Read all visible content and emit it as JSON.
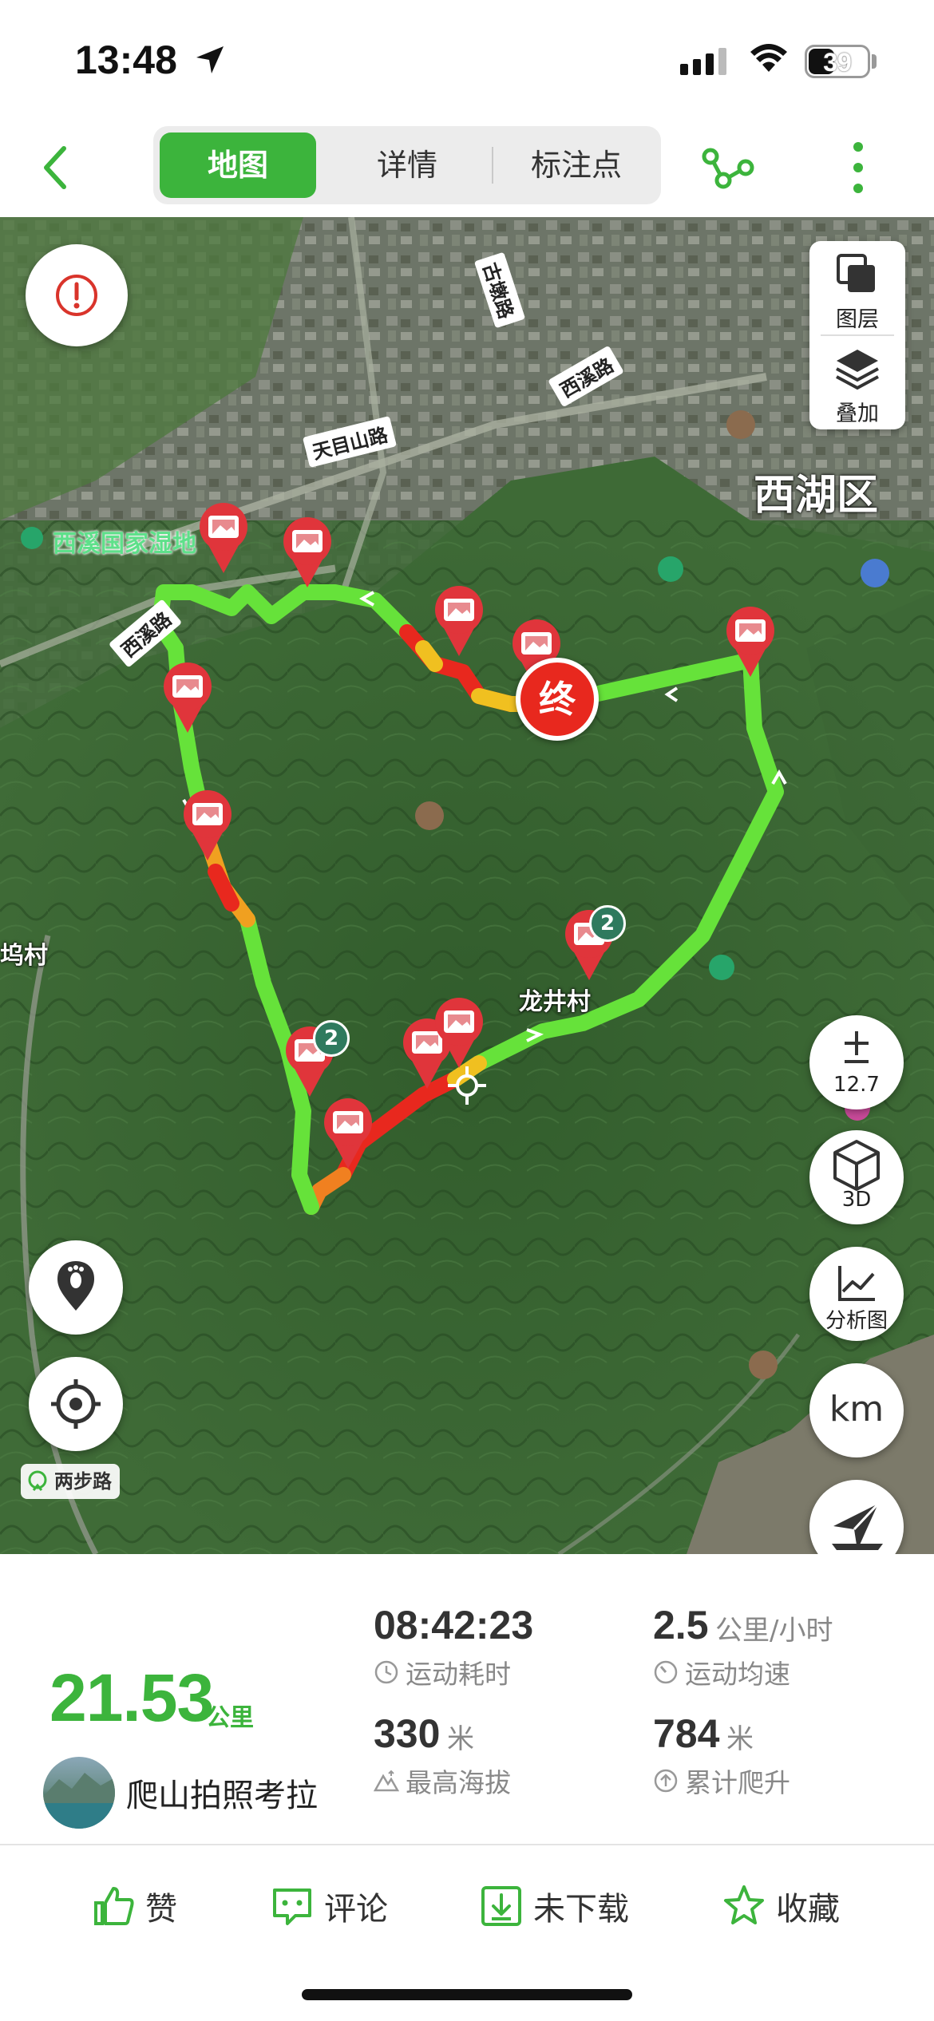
{
  "status_bar": {
    "time": "13:48",
    "battery": "39"
  },
  "header": {
    "tabs": [
      {
        "label": "地图",
        "active": true
      },
      {
        "label": "详情",
        "active": false
      },
      {
        "label": "标注点",
        "active": false
      }
    ]
  },
  "map": {
    "place_labels": {
      "district": "西湖区",
      "wetland": "西溪国家湿地",
      "longjing": "龙井村",
      "wu_village": "坞村"
    },
    "road_labels": {
      "tianmushan": "天目山路",
      "xixi_top": "西溪路",
      "xixi_left": "西溪路",
      "gudun": "古墩路"
    },
    "end_marker": "终",
    "cluster_counts": [
      "2",
      "2"
    ],
    "controls": {
      "layers": "图层",
      "overlay": "叠加",
      "zoom_level": "12.7",
      "view_3d": "3D",
      "analysis": "分析图",
      "unit": "km"
    },
    "brand": "两步路",
    "route_color_scale": {
      "fast": "#66e23a",
      "medium": "#f0c020",
      "slow": "#e8281e"
    }
  },
  "stats": {
    "distance": "21.53",
    "distance_unit": "公里",
    "duration": "08:42:23",
    "duration_label": "运动耗时",
    "avg_speed": "2.5",
    "avg_speed_unit": "公里/小时",
    "avg_speed_label": "运动均速",
    "max_altitude": "330",
    "max_altitude_unit": "米",
    "max_altitude_label": "最高海拔",
    "total_climb": "784",
    "total_climb_unit": "米",
    "total_climb_label": "累计爬升",
    "username": "爬山拍照考拉"
  },
  "actions": {
    "like": "赞",
    "comment": "评论",
    "download": "未下载",
    "favorite": "收藏"
  },
  "colors": {
    "accent": "#3cb43c",
    "marker": "#e0353b"
  }
}
